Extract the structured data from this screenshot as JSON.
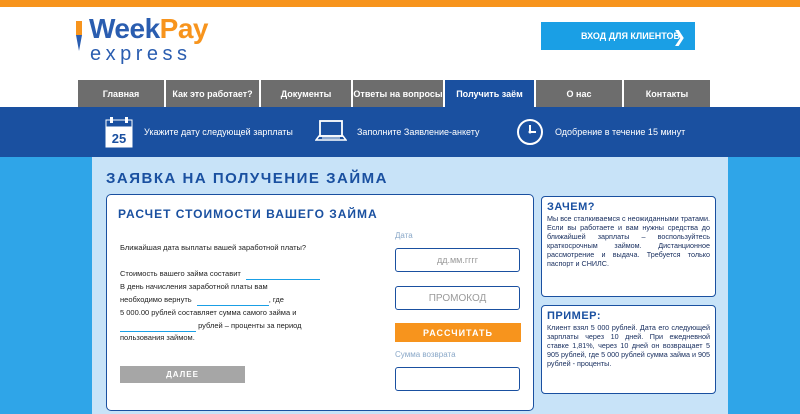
{
  "logo": {
    "part1": "Week",
    "part2": "Pay",
    "part3": "express"
  },
  "header": {
    "login_label": "ВХОД ДЛЯ КЛИЕНТОВ",
    "login_chevron": "❯"
  },
  "nav": [
    {
      "label": "Главная"
    },
    {
      "label": "Как это работает?"
    },
    {
      "label": "Документы"
    },
    {
      "label": "Ответы на вопросы"
    },
    {
      "label": "Получить заём"
    },
    {
      "label": "О нас"
    },
    {
      "label": "Контакты"
    }
  ],
  "steps": [
    {
      "icon": "calendar-icon",
      "text": "Укажите дату следующей зарплаты",
      "calendar_day": "25"
    },
    {
      "icon": "laptop-icon",
      "text": "Заполните Заявление-анкету"
    },
    {
      "icon": "clock-icon",
      "text": "Одобрение в течение 15 минут"
    }
  ],
  "main": {
    "title": "ЗАЯВКА НА ПОЛУЧЕНИЕ ЗАЙМА",
    "calc_title": "РАСЧЕТ СТОИМОСТИ ВАШЕГО ЗАЙМА",
    "question": "Ближайшая дата выплаты вашей заработной платы?",
    "cost_text": "Стоимость вашего займа составит",
    "line2": "В день начисления заработной платы вам",
    "line3a": "необходимо вернуть",
    "line3b": ", где",
    "line4": "5 000.00 рублей составляет сумма самого займа и",
    "line5b": " рублей – проценты за период",
    "line6": "пользования займом.",
    "date_label": "Дата",
    "date_placeholder": "дд.мм.гггг",
    "promo_placeholder": "ПРОМОКОД",
    "calc_button": "РАССЧИТАТЬ",
    "return_label": "Сумма возврата",
    "next_button": "ДАЛЕЕ"
  },
  "sidebar": {
    "why_title": "ЗАЧЕМ?",
    "why_text": "Мы все сталкиваемся с неожиданными тратами. Если вы работаете и вам нужны средства до ближайшей зарплаты – воспользуйтесь краткосрочным займом. Дистанционное рассмотрение и выдача. Требуется только паспорт и СНИЛС.",
    "example_title": "ПРИМЕР:",
    "example_text": "Клиент взял 5 000 рублей. Дата его следующей зарплаты через 10 дней. При ежедневной ставке 1,81%, через 10 дней он возвращает 5 905 рублей, где 5 000 рублей сумма займа и 905 рублей - проценты."
  },
  "colors": {
    "accent": "#f7941d",
    "brand": "#1a50a0",
    "light": "#c8e3f8",
    "sky": "#2fa5e8"
  }
}
